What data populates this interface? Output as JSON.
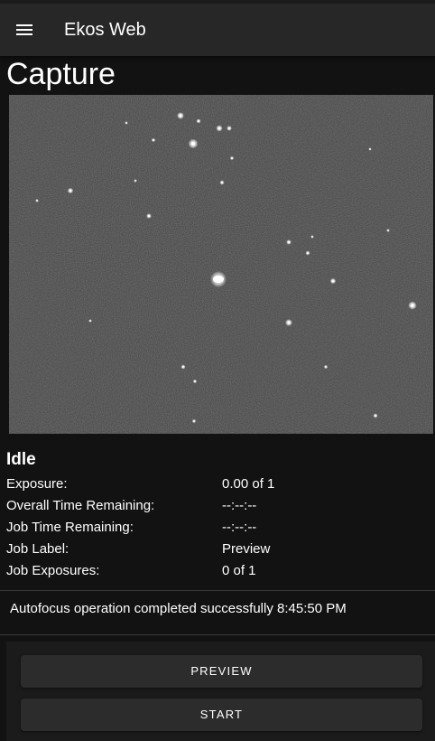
{
  "appbar": {
    "menu_icon": "hamburger-menu-icon",
    "title": "Ekos Web"
  },
  "page": {
    "title": "Capture"
  },
  "preview": {
    "image_description": "starfield-preview"
  },
  "status": {
    "state": "Idle",
    "rows": [
      {
        "label": "Exposure:",
        "value": "0.00 of 1"
      },
      {
        "label": "Overall Time Remaining:",
        "value": "--:--:--"
      },
      {
        "label": "Job Time Remaining:",
        "value": "--:--:--"
      },
      {
        "label": "Job Label:",
        "value": "Preview"
      },
      {
        "label": "Job Exposures:",
        "value": "0 of 1"
      }
    ]
  },
  "log": {
    "message": "Autofocus operation completed successfully 8:45:50 PM"
  },
  "actions": {
    "preview_label": "PREVIEW",
    "start_label": "START"
  }
}
